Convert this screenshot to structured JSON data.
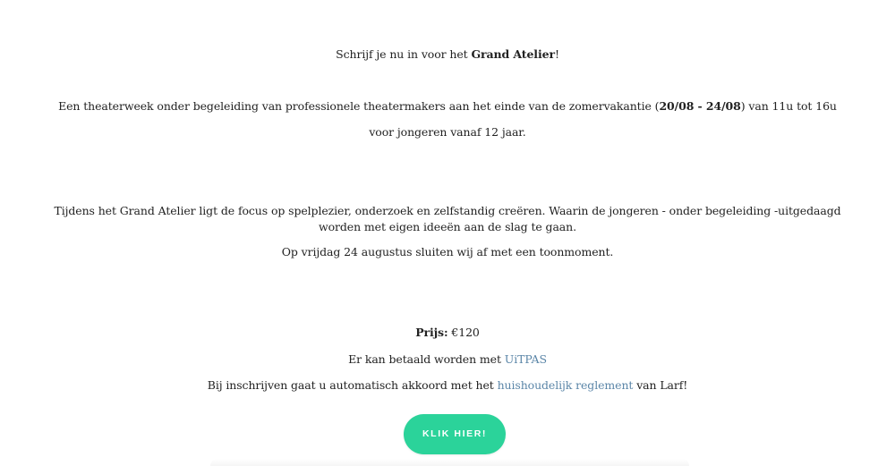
{
  "intro": {
    "prefix": "Schrijf je nu in voor het ",
    "bold": "Grand Atelier",
    "suffix": "!"
  },
  "description": {
    "line1_prefix": "Een theaterweek onder begeleiding van professionele theatermakers aan het einde van de zomervakantie (",
    "line1_bold": "20/08 - 24/08",
    "line1_suffix": ") van 11u tot 16u",
    "line2": "voor jongeren vanaf 12 jaar."
  },
  "focus": {
    "line1": "Tijdens het Grand Atelier ligt de focus op spelplezier, onderzoek en zelfstandig creëren. Waarin de jongeren - onder begeleiding -uitgedaagd",
    "line2": "worden met eigen ideeën aan de slag te gaan.",
    "line3": "Op vrijdag 24 augustus sluiten wij af met een toonmoment."
  },
  "price": {
    "label": "Prijs",
    "colon": ":",
    "value": " €120"
  },
  "payment": {
    "prefix": "Er kan betaald worden met ",
    "link": "UiTPAS"
  },
  "rules": {
    "prefix": "Bij inschrijven gaat u automatisch akkoord met het ",
    "link": "huishoudelijk reglement",
    "suffix": " van Larf!"
  },
  "cta": {
    "label": "KLIK HIER!"
  },
  "colors": {
    "cta_background": "#2bd39a",
    "link": "#5b86a8",
    "text": "#222222"
  }
}
